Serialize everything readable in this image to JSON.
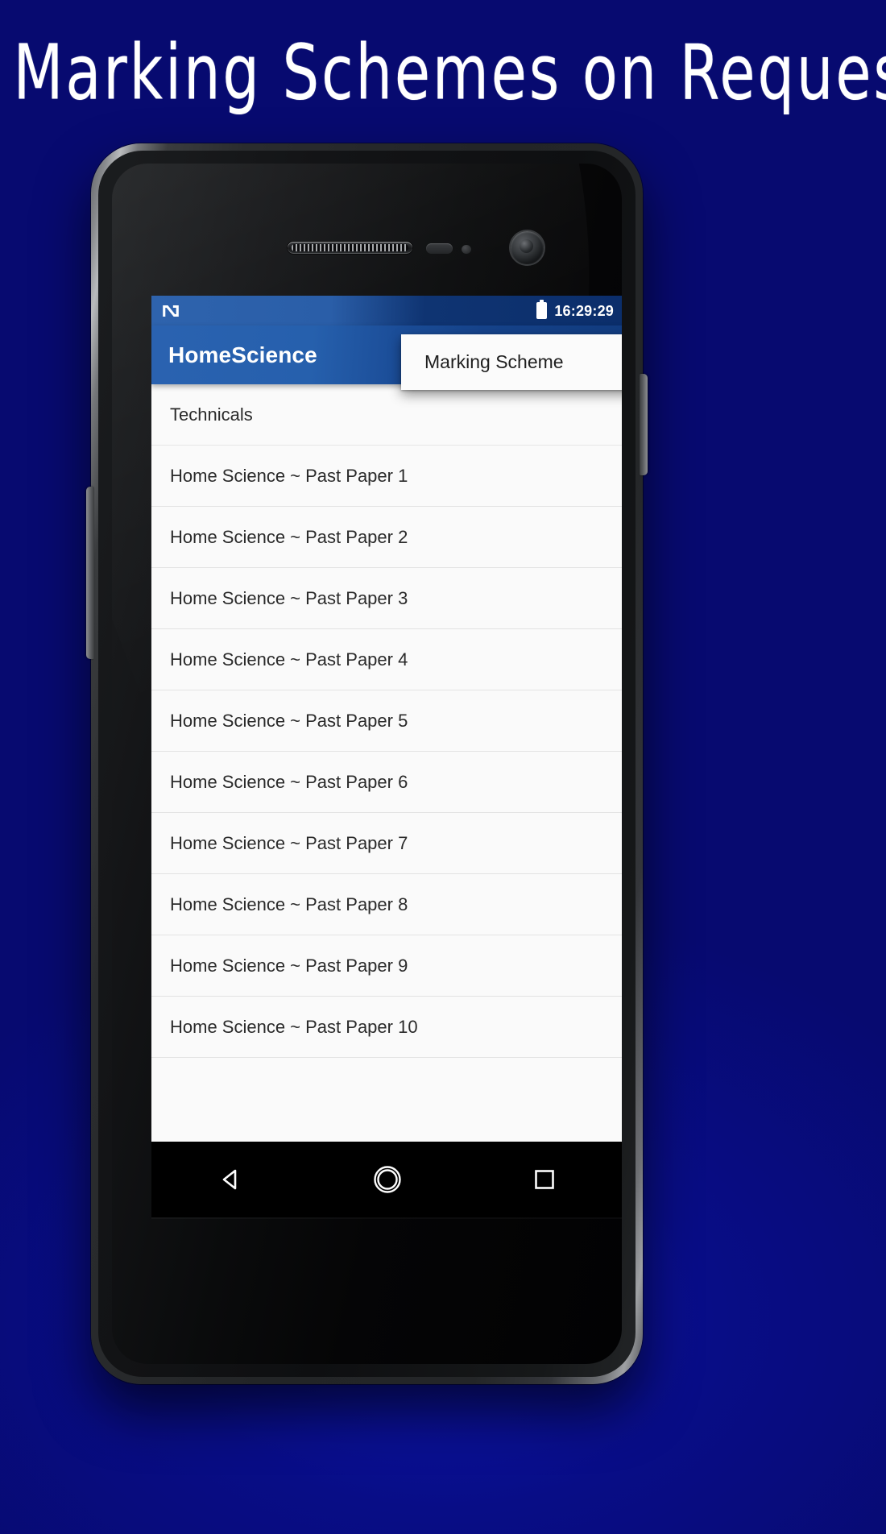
{
  "promo": {
    "headline": "Marking Schemes on Request",
    "background_color": "#0a0c82",
    "headline_color": "#ffffff"
  },
  "device": {
    "name": "android-phone-mockup",
    "hardware": {
      "earpiece": "earpiece-speaker",
      "proximity_sensor": "proximity-sensor",
      "light_sensor": "ambient-light-sensor",
      "front_camera": "front-camera",
      "volume_rocker": "volume-rocker",
      "power_button": "power-button"
    }
  },
  "status_bar": {
    "notification_icon": "app-notification-icon",
    "battery_icon": "battery-icon",
    "time": "16:29:29",
    "background_color": "#0b2e6b",
    "text_color": "#ffffff"
  },
  "action_bar": {
    "title": "HomeScience",
    "background_color": "#123c80",
    "title_color": "#ffffff"
  },
  "overflow_menu": {
    "open": true,
    "items": [
      {
        "label": "Marking Scheme"
      }
    ],
    "background_color": "#fbfbfb",
    "text_color": "#1f1f1f"
  },
  "list": {
    "items": [
      {
        "label": "Technicals",
        "type": "category"
      },
      {
        "label": "Home Science ~ Past Paper 1",
        "type": "paper"
      },
      {
        "label": "Home Science ~ Past Paper 2",
        "type": "paper"
      },
      {
        "label": "Home Science ~ Past Paper 3",
        "type": "paper"
      },
      {
        "label": "Home Science ~ Past Paper 4",
        "type": "paper"
      },
      {
        "label": "Home Science ~ Past Paper 5",
        "type": "paper"
      },
      {
        "label": "Home Science ~ Past Paper 6",
        "type": "paper"
      },
      {
        "label": "Home Science ~ Past Paper 7",
        "type": "paper"
      },
      {
        "label": "Home Science ~ Past Paper 8",
        "type": "paper"
      },
      {
        "label": "Home Science ~ Past Paper 9",
        "type": "paper"
      },
      {
        "label": "Home Science ~ Past Paper 10",
        "type": "paper"
      }
    ],
    "background_color": "#fafafa",
    "divider_color": "#e3e3e3",
    "text_color": "#2a2a2a"
  },
  "nav_bar": {
    "background_color": "#000000",
    "buttons": [
      {
        "name": "back-button",
        "icon": "back-triangle-icon"
      },
      {
        "name": "home-button",
        "icon": "home-circle-icon"
      },
      {
        "name": "recents-button",
        "icon": "recents-square-icon"
      }
    ]
  }
}
